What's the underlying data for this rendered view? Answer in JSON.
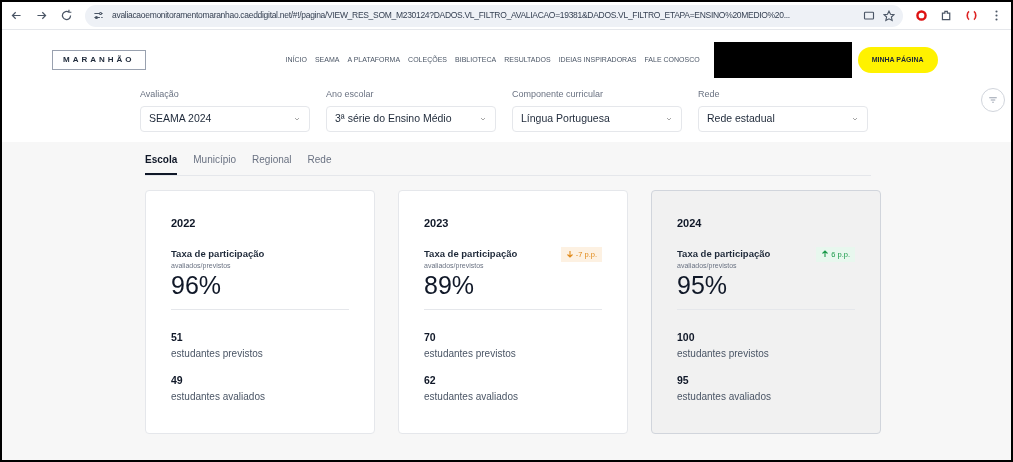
{
  "browser": {
    "url": "avaliacaoemonitoramentomaranhao.caeddigital.net/#!/pagina/VIEW_RES_SOM_M230124?DADOS.VL_FILTRO_AVALIACAO=19381&DADOS.VL_FILTRO_ETAPA=ENSINO%20MEDIO%20..."
  },
  "header": {
    "logo": "MARANHÃO",
    "nav": [
      "INÍCIO",
      "SEAMA",
      "A PLATAFORMA",
      "COLEÇÕES",
      "BIBLIOTECA",
      "RESULTADOS",
      "IDEIAS INSPIRADORAS",
      "FALE CONOSCO"
    ],
    "cta": "MINHA PÁGINA"
  },
  "filters": [
    {
      "label": "Avaliação",
      "value": "SEAMA 2024"
    },
    {
      "label": "Ano escolar",
      "value": "3ª série do Ensino Médio"
    },
    {
      "label": "Componente curricular",
      "value": "Língua Portuguesa"
    },
    {
      "label": "Rede",
      "value": "Rede estadual"
    }
  ],
  "tabs": [
    {
      "label": "Escola",
      "selected": true
    },
    {
      "label": "Município",
      "selected": false
    },
    {
      "label": "Regional",
      "selected": false
    },
    {
      "label": "Rede",
      "selected": false
    }
  ],
  "cards": [
    {
      "year": "2022",
      "selected": false,
      "metric": "Taxa de participação",
      "sub": "avaliados/previstos",
      "value": "96%",
      "stats": [
        {
          "value": "51",
          "label": "estudantes previstos"
        },
        {
          "value": "49",
          "label": "estudantes avaliados"
        }
      ]
    },
    {
      "year": "2023",
      "selected": false,
      "metric": "Taxa de participação",
      "sub": "avaliados/previstos",
      "value": "89%",
      "delta": {
        "kind": "down",
        "text": "-7 p.p."
      },
      "stats": [
        {
          "value": "70",
          "label": "estudantes previstos"
        },
        {
          "value": "62",
          "label": "estudantes avaliados"
        }
      ]
    },
    {
      "year": "2024",
      "selected": true,
      "metric": "Taxa de participação",
      "sub": "avaliados/previstos",
      "value": "95%",
      "delta": {
        "kind": "up",
        "text": "6 p.p."
      },
      "stats": [
        {
          "value": "100",
          "label": "estudantes previstos"
        },
        {
          "value": "95",
          "label": "estudantes avaliados"
        }
      ]
    }
  ]
}
